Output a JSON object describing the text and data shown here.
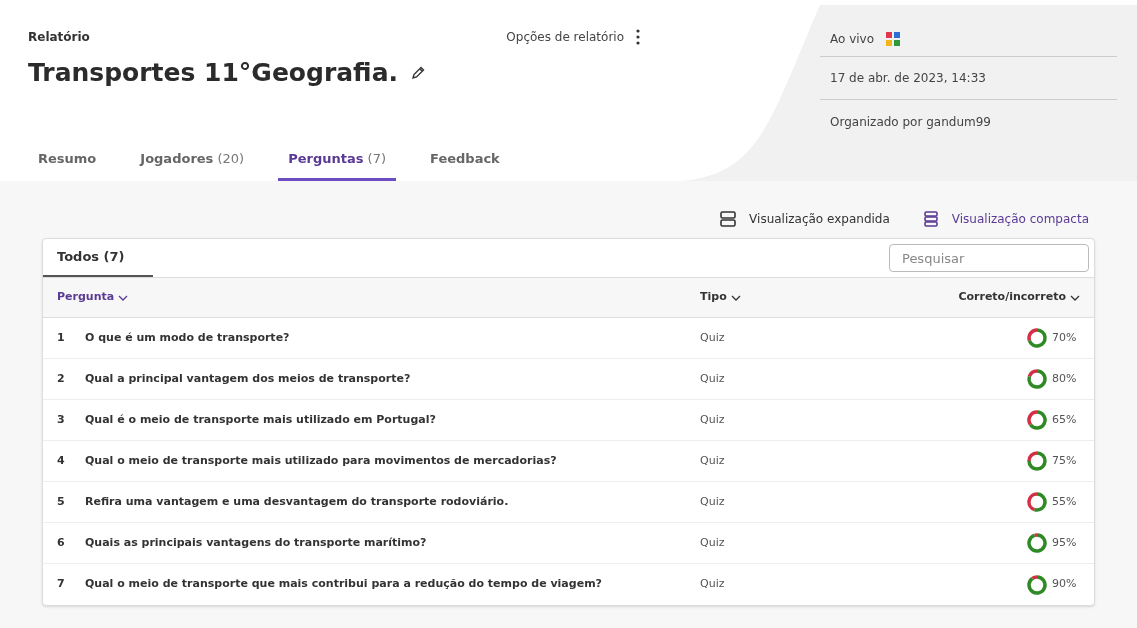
{
  "header": {
    "breadcrumb": "Relatório",
    "title": "Transportes 11°Geografia.",
    "options_label": "Opções de relatório"
  },
  "info": {
    "mode": "Ao vivo",
    "date": "17 de abr. de 2023, 14:33",
    "host": "Organizado por gandum99"
  },
  "tabs": [
    {
      "label": "Resumo",
      "selected": false
    },
    {
      "label": "Jogadores",
      "count": "(20)",
      "selected": false
    },
    {
      "label": "Perguntas",
      "count": "(7)",
      "selected": true
    },
    {
      "label": "Feedback",
      "selected": false
    }
  ],
  "views": [
    {
      "kind": "expanded",
      "label": "Visualização expandida",
      "selected": false
    },
    {
      "kind": "compact",
      "label": "Visualização compacta",
      "selected": true
    }
  ],
  "filter_tab": {
    "label": "Todos (7)",
    "selected": true
  },
  "search": {
    "placeholder": "Pesquisar"
  },
  "table": {
    "columns": [
      "Pergunta",
      "Tipo",
      "Correto/incorreto"
    ],
    "rows": [
      {
        "number": "1",
        "question": "O que é um modo de transporte?",
        "type": "Quiz",
        "reading": "70%"
      },
      {
        "number": "2",
        "question": "Qual a principal vantagem dos meios de transporte?",
        "type": "Quiz",
        "reading": "80%"
      },
      {
        "number": "3",
        "question": "Qual é o meio de transporte mais utilizado em Portugal?",
        "type": "Quiz",
        "reading": "65%"
      },
      {
        "number": "4",
        "question": "Qual o meio de transporte mais utilizado para movimentos de mercadorias?",
        "type": "Quiz",
        "reading": "75%"
      },
      {
        "number": "5",
        "question": "Refira uma vantagem e uma desvantagem do transporte rodoviário.",
        "type": "Quiz",
        "reading": "55%"
      },
      {
        "number": "6",
        "question": "Quais as principais vantagens do transporte marítimo?",
        "type": "Quiz",
        "reading": "95%"
      },
      {
        "number": "7",
        "question": "Qual o meio de transporte que mais contribui para a redução do tempo de viagem?",
        "type": "Quiz",
        "reading": "90%"
      }
    ]
  }
}
